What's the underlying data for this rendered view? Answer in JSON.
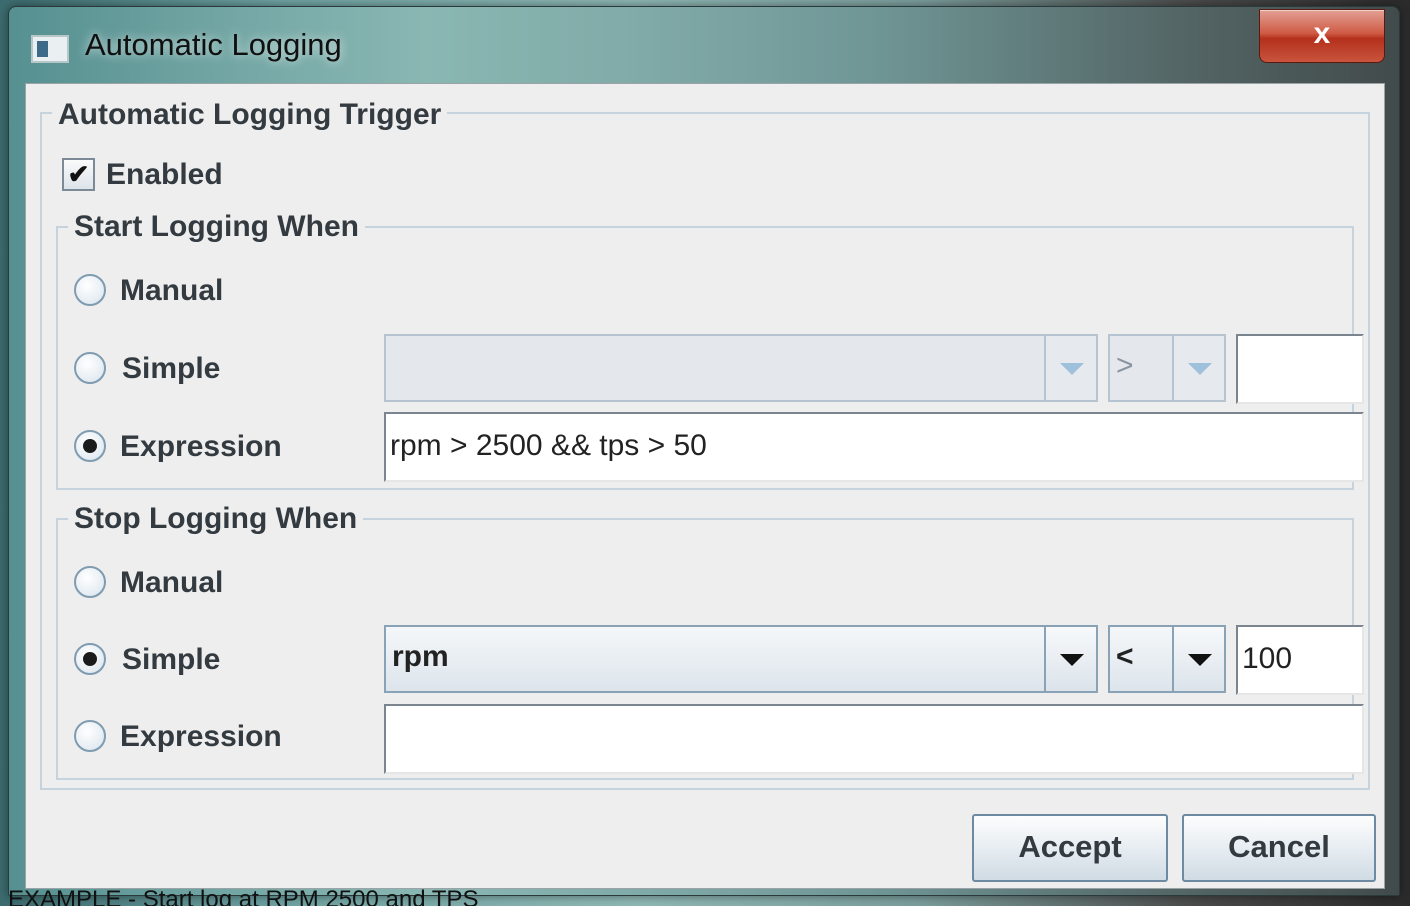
{
  "window": {
    "title": "Automatic Logging",
    "close_label": "x"
  },
  "trigger": {
    "legend": "Automatic Logging Trigger",
    "enabled_label": "Enabled",
    "enabled_mark": "✔"
  },
  "start": {
    "legend": "Start Logging When",
    "manual_label": "Manual",
    "simple_label": "Simple",
    "expression_label": "Expression",
    "selected": "Expression",
    "simple_parameter": "",
    "simple_operator": ">",
    "simple_value": "",
    "expression_value": "rpm > 2500 && tps > 50"
  },
  "stop": {
    "legend": "Stop Logging When",
    "manual_label": "Manual",
    "simple_label": "Simple",
    "expression_label": "Expression",
    "selected": "Simple",
    "simple_parameter": "rpm",
    "simple_operator": "<",
    "simple_value": "100",
    "expression_value": ""
  },
  "buttons": {
    "accept": "Accept",
    "cancel": "Cancel"
  },
  "caption": "EXAMPLE - Start log at RPM 2500 and TPS"
}
